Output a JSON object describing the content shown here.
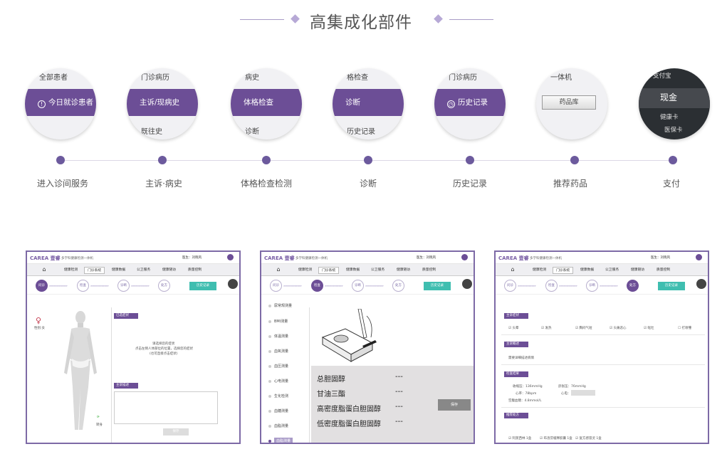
{
  "header": {
    "title": "高集成化部件"
  },
  "steps": [
    {
      "label": "进入诊间服务",
      "above": "全部患者",
      "band": "今日就诊患者",
      "below": ""
    },
    {
      "label": "主诉·病史",
      "above": "门诊病历",
      "band": "主诉/现病史",
      "below": "既往史"
    },
    {
      "label": "体格检查检测",
      "above": "病史",
      "band": "体格检查",
      "below": "诊断"
    },
    {
      "label": "诊断",
      "above": "格检查",
      "band": "诊断",
      "below": "历史记录"
    },
    {
      "label": "历史记录",
      "above": "门诊病历",
      "band": "历史记录",
      "below": ""
    },
    {
      "label": "推荐药品",
      "above": "一体机",
      "band": "药品库",
      "below": ""
    },
    {
      "label": "支付",
      "above": "支付宝",
      "band": "现金",
      "below": "健康卡",
      "extra": "医保卡"
    }
  ],
  "shot_common": {
    "logo": "CAREA 壹睿",
    "app_title": "多学科健康检测一体机",
    "user": "医生：刘晓风",
    "tabs": [
      "健康检测",
      "门诊系统",
      "健康数据",
      "公卫服务",
      "健康随访",
      "质量控制"
    ],
    "history_btn": "历史记录"
  },
  "shot1": {
    "steps": [
      "问诊",
      "检查",
      "诊断",
      "处方"
    ],
    "sex_label": "性别:女",
    "section1": "已选症状",
    "hint": "请选择您的症状",
    "hint2": "点击左侧人体部位的位置，选择您的症状",
    "hint3": "(也可直接点击症状)",
    "section2": "主诉描述",
    "flip": "转身",
    "save": "保存"
  },
  "shot2": {
    "steps": [
      "问诊",
      "检查",
      "诊断",
      "处方"
    ],
    "menu": [
      "尿常规测量",
      "BMI测量",
      "体温测量",
      "血氧测量",
      "血压测量",
      "心电测量",
      "生化检测",
      "血糖测量",
      "血脂测量",
      "血脂测量"
    ],
    "rows": [
      {
        "name": "总胆固醇",
        "value": "---"
      },
      {
        "name": "甘油三酯",
        "value": "---"
      },
      {
        "name": "高密度脂蛋白胆固醇",
        "value": "---"
      },
      {
        "name": "低密度脂蛋白胆固醇",
        "value": "---"
      }
    ],
    "save": "保存"
  },
  "shot3": {
    "steps": [
      "问诊",
      "检查",
      "诊断",
      "处方"
    ],
    "sec_symptom": "主诉症状",
    "symptoms": [
      "头晕",
      "发热",
      "胸闷气短",
      "头痛恶心",
      "呕吐",
      "打喷嚏"
    ],
    "sec_history": "主诉概述",
    "history_text": "需要详细描述病情",
    "sec_exam": "检查结果",
    "exam": [
      "收缩压：136mmHg",
      "舒张压：76mmHg",
      "心率：78bpm",
      "心电：",
      "空腹血糖：4.8mmol/L"
    ],
    "sec_rx": "推荐处方",
    "rx": [
      "阿莫西林 1盒",
      "布洛芬缓释胶囊 1盒",
      "复方感冒灵 1盒"
    ]
  }
}
